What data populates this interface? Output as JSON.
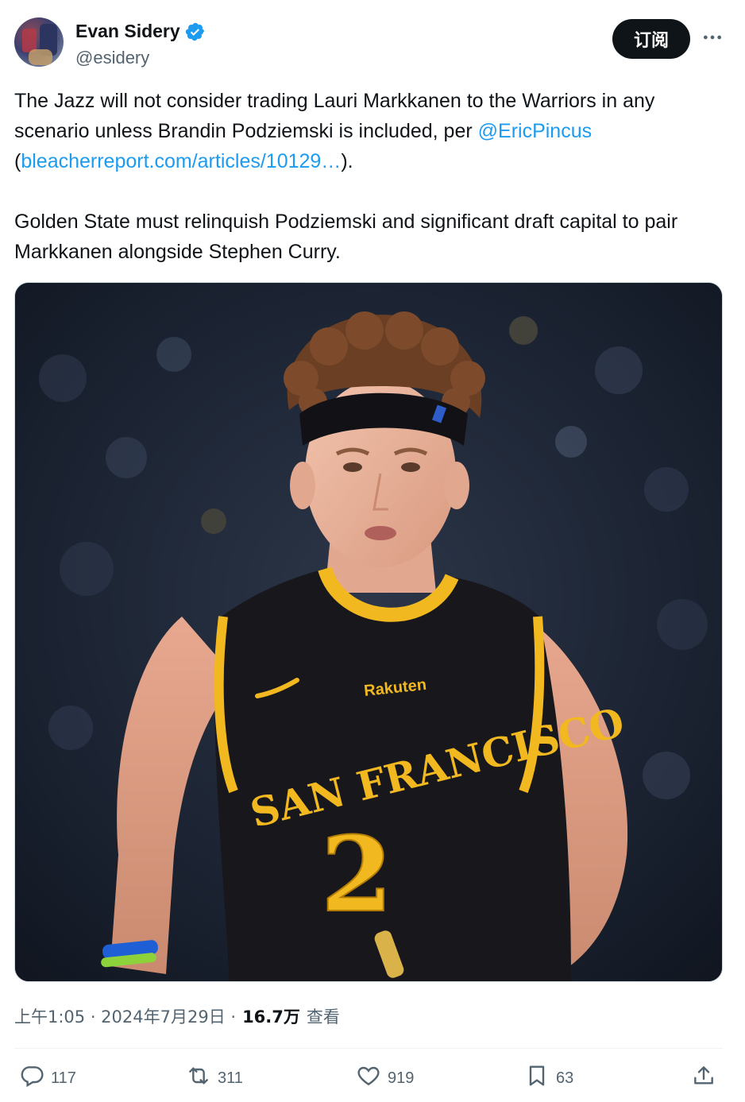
{
  "author": {
    "display_name": "Evan Sidery",
    "handle": "@esidery",
    "verified": true
  },
  "header": {
    "subscribe_label": "订阅",
    "more_icon": "more-horizontal-icon"
  },
  "tweet": {
    "text_1": "The Jazz will not consider trading Lauri Markkanen to the Warriors in any scenario unless Brandin Podziemski is included, per ",
    "mention": "@EricPincus",
    "paren_open": "(",
    "link": "bleacherreport.com/articles/10129…",
    "paren_close": ").",
    "text_2": "Golden State must relinquish Podziemski and significant draft capital to pair Markkanen alongside Stephen Curry."
  },
  "media": {
    "jersey_team": "SAN FRANCISCO",
    "jersey_number": "2",
    "sponsor": "Rakuten"
  },
  "meta": {
    "timestamp": "上午1:05 · 2024年7月29日 · ",
    "views_count": "16.7万",
    "views_label": "查看"
  },
  "actions": {
    "replies": "117",
    "reposts": "311",
    "likes": "919",
    "bookmarks": "63"
  },
  "colors": {
    "accent": "#1d9bf0",
    "text": "#0f1419",
    "muted": "#536471",
    "jersey_gold": "#f2b81f"
  }
}
